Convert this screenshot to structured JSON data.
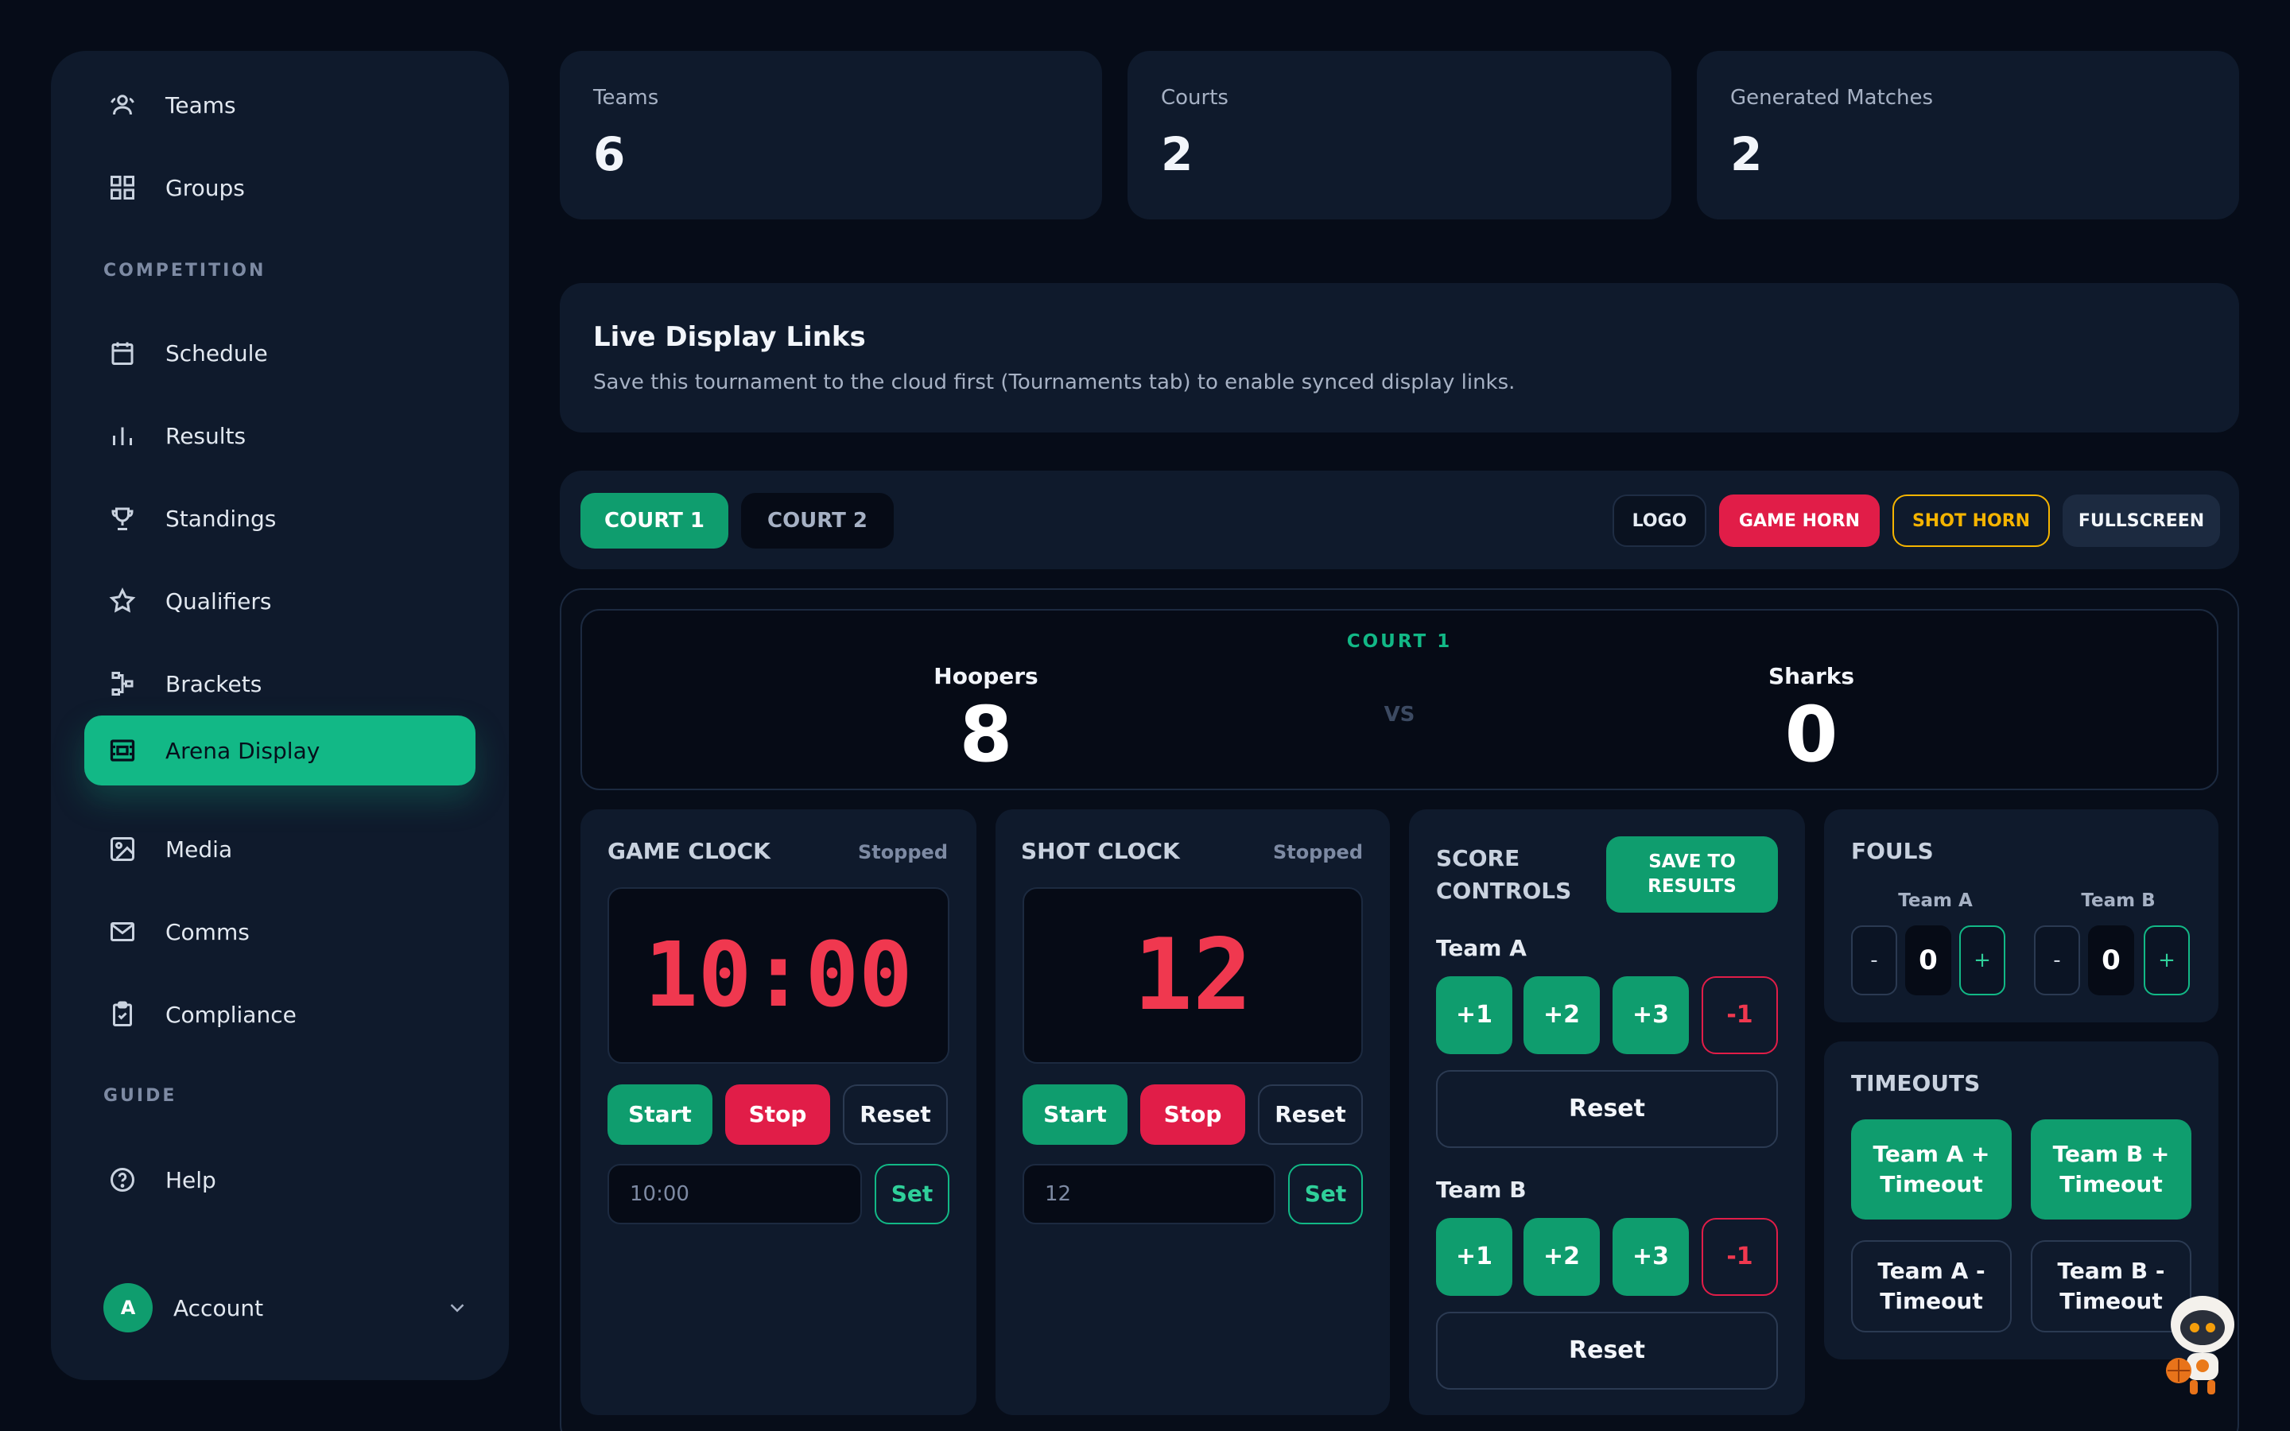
{
  "sidebar": {
    "items_top": [
      {
        "label": "Teams",
        "icon": "users-icon"
      },
      {
        "label": "Groups",
        "icon": "grid-icon"
      }
    ],
    "section_competition": "COMPETITION",
    "items_competition": [
      {
        "label": "Schedule",
        "icon": "calendar-icon"
      },
      {
        "label": "Results",
        "icon": "bar-chart-icon"
      },
      {
        "label": "Standings",
        "icon": "trophy-icon"
      },
      {
        "label": "Qualifiers",
        "icon": "star-icon"
      },
      {
        "label": "Brackets",
        "icon": "bracket-icon"
      },
      {
        "label": "Arena Display",
        "icon": "display-icon",
        "active": true
      },
      {
        "label": "Media",
        "icon": "image-icon"
      },
      {
        "label": "Comms",
        "icon": "mail-icon"
      },
      {
        "label": "Compliance",
        "icon": "clipboard-check-icon"
      }
    ],
    "section_guide": "GUIDE",
    "items_guide": [
      {
        "label": "Help",
        "icon": "help-icon"
      }
    ],
    "account": {
      "avatar": "A",
      "label": "Account"
    }
  },
  "stats": [
    {
      "label": "Teams",
      "value": "6"
    },
    {
      "label": "Courts",
      "value": "2"
    },
    {
      "label": "Generated Matches",
      "value": "2"
    }
  ],
  "live_links": {
    "title": "Live Display Links",
    "description": "Save this tournament to the cloud first (Tournaments tab) to enable synced display links."
  },
  "tabs": {
    "court1": "COURT 1",
    "court2": "COURT 2",
    "logo": "LOGO",
    "game_horn": "GAME HORN",
    "shot_horn": "SHOT HORN",
    "fullscreen": "FULLSCREEN"
  },
  "scoreboard": {
    "court": "COURT 1",
    "team_a": {
      "name": "Hoopers",
      "score": "8"
    },
    "team_b": {
      "name": "Sharks",
      "score": "0"
    },
    "vs": "VS"
  },
  "game_clock": {
    "title": "GAME CLOCK",
    "status": "Stopped",
    "display": "10:00",
    "start": "Start",
    "stop": "Stop",
    "reset": "Reset",
    "input_value": "10:00",
    "set": "Set"
  },
  "shot_clock": {
    "title": "SHOT CLOCK",
    "status": "Stopped",
    "display": "12",
    "start": "Start",
    "stop": "Stop",
    "reset": "Reset",
    "input_value": "12",
    "set": "Set"
  },
  "score_controls": {
    "title_line1": "SCORE",
    "title_line2": "CONTROLS",
    "save_line1": "SAVE TO",
    "save_line2": "RESULTS",
    "team_a": "Team A",
    "team_b": "Team B",
    "plus1": "+1",
    "plus2": "+2",
    "plus3": "+3",
    "minus1": "-1",
    "reset": "Reset"
  },
  "fouls": {
    "title": "FOULS",
    "team_a": "Team A",
    "team_b": "Team B",
    "minus": "-",
    "plus": "+",
    "a_value": "0",
    "b_value": "0"
  },
  "timeouts": {
    "title": "TIMEOUTS",
    "a_plus_line1": "Team A +",
    "a_plus_line2": "Timeout",
    "b_plus_line1": "Team B +",
    "b_plus_line2": "Timeout",
    "a_minus_line1": "Team A -",
    "a_minus_line2": "Timeout",
    "b_minus_line1": "Team B -",
    "b_minus_line2": "Timeout"
  },
  "colors": {
    "accent": "#12b886",
    "danger": "#e11d48",
    "warning": "#f5b400",
    "led": "#f0384f",
    "background": "#060c18",
    "card": "#0f1a2c"
  }
}
